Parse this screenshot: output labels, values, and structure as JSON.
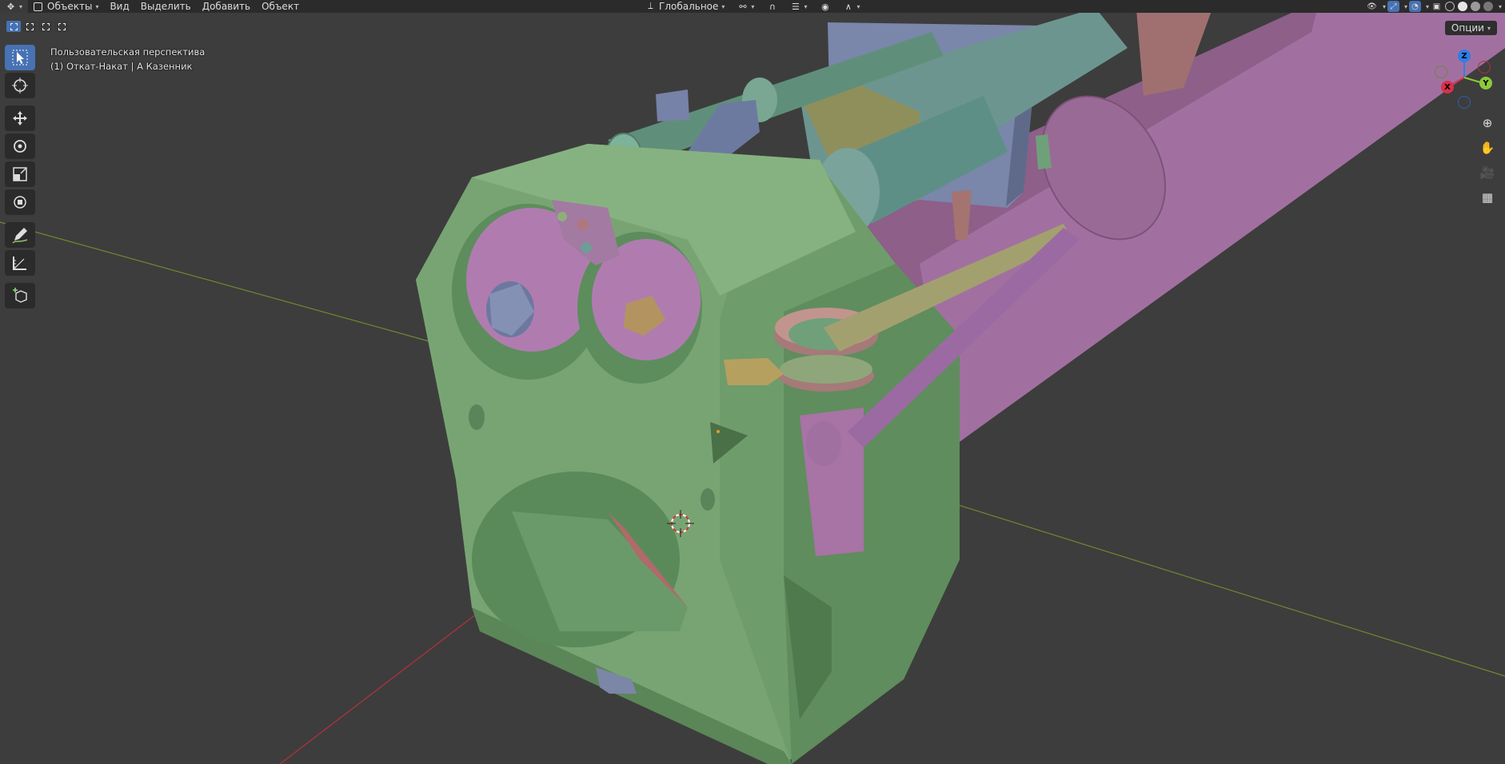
{
  "header": {
    "mode": "Объекты",
    "menus": [
      "Вид",
      "Выделить",
      "Добавить",
      "Объект"
    ],
    "transform_orientation": "Глобальное"
  },
  "viewport": {
    "view_name": "Пользовательская перспектива",
    "collection_info": "(1) Откат-Накат | А Казенник",
    "options_label": "Опции"
  },
  "gizmo": {
    "x_label": "X",
    "y_label": "Y",
    "z_label": "Z"
  },
  "colors": {
    "accent": "#4772b3",
    "header_bg": "#2b2b2b",
    "viewport_bg": "#3d3d3d",
    "axis_x": "#d9304a",
    "axis_y": "#8bc93a",
    "axis_z": "#2f7dea",
    "model_green": "#6f9c6b",
    "model_pink": "#9b6c9b",
    "model_teal": "#5e8c86",
    "model_olive": "#8f8e5e",
    "model_blue": "#7783a6"
  },
  "toolbar": {
    "tools": [
      "select-box",
      "cursor",
      "move",
      "rotate",
      "scale",
      "transform",
      "annotate",
      "measure",
      "add-cube"
    ]
  }
}
